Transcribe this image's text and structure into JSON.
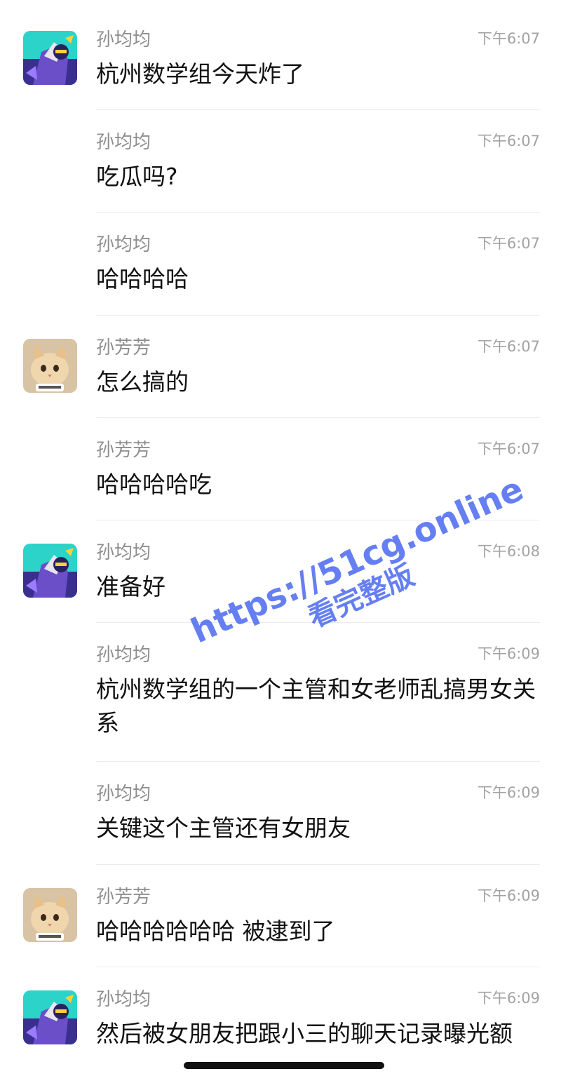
{
  "messages": [
    {
      "sender": "孙均均",
      "time": "下午6:07",
      "text": "杭州数学组今天炸了",
      "avatar": "anime-character-avatar"
    },
    {
      "sender": "孙均均",
      "time": "下午6:07",
      "text": "吃瓜吗?",
      "avatar": null
    },
    {
      "sender": "孙均均",
      "time": "下午6:07",
      "text": "哈哈哈哈",
      "avatar": null
    },
    {
      "sender": "孙芳芳",
      "time": "下午6:07",
      "text": "怎么搞的",
      "avatar": "cat-avatar"
    },
    {
      "sender": "孙芳芳",
      "time": "下午6:07",
      "text": "哈哈哈哈吃",
      "avatar": null
    },
    {
      "sender": "孙均均",
      "time": "下午6:08",
      "text": "准备好",
      "avatar": "anime-character-avatar"
    },
    {
      "sender": "孙均均",
      "time": "下午6:09",
      "text": "杭州数学组的一个主管和女老师乱搞男女关系",
      "avatar": null
    },
    {
      "sender": "孙均均",
      "time": "下午6:09",
      "text": "关键这个主管还有女朋友",
      "avatar": null
    },
    {
      "sender": "孙芳芳",
      "time": "下午6:09",
      "text": "哈哈哈哈哈哈 被逮到了",
      "avatar": "cat-avatar"
    },
    {
      "sender": "孙均均",
      "time": "下午6:09",
      "text": "然后被女朋友把跟小三的聊天记录曝光额",
      "avatar": "anime-character-avatar"
    }
  ],
  "watermark": {
    "url": "https://51cg.online",
    "subtitle": "看完整版",
    "color": "#3a5cf0"
  },
  "colors": {
    "sender": "#8e8e8e",
    "time": "#a3a3a3",
    "text": "#111111",
    "divider": "#ebebeb"
  }
}
